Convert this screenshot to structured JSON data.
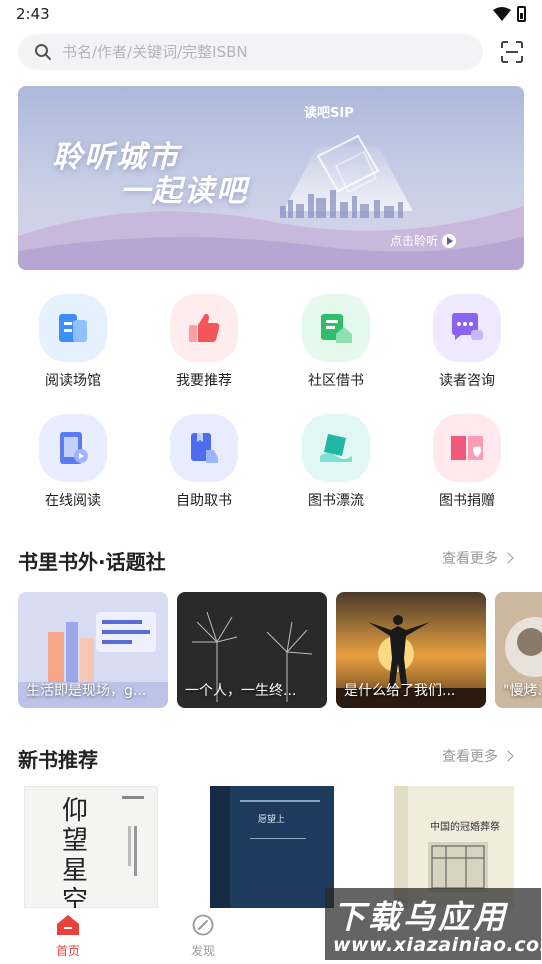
{
  "status_bar": {
    "time": "2:43"
  },
  "search": {
    "placeholder": "书名/作者/关键词/完整ISBN"
  },
  "banner": {
    "title_line1": "聆听城市",
    "title_line2": "一起读吧",
    "brand": "读吧SIP",
    "listen_label": "点击聆听"
  },
  "services": [
    {
      "label": "阅读场馆",
      "icon": "building-icon",
      "color": "#3d8ef8"
    },
    {
      "label": "我要推荐",
      "icon": "thumbs-up-icon",
      "color": "#f2555a"
    },
    {
      "label": "社区借书",
      "icon": "house-book-icon",
      "color": "#2fbf6a"
    },
    {
      "label": "读者咨询",
      "icon": "chat-bubble-icon",
      "color": "#8a64f0"
    },
    {
      "label": "在线阅读",
      "icon": "tablet-icon",
      "color": "#5b7bf0"
    },
    {
      "label": "自助取书",
      "icon": "pickup-icon",
      "color": "#4d6cf0"
    },
    {
      "label": "图书漂流",
      "icon": "drift-icon",
      "color": "#1fb8a6"
    },
    {
      "label": "图书捐赠",
      "icon": "heart-book-icon",
      "color": "#f05a7a"
    }
  ],
  "topics_section": {
    "title": "书里书外·话题社",
    "more_label": "查看更多",
    "items": [
      {
        "caption": "生活即是现场，g..."
      },
      {
        "caption": "一个人，一生终..."
      },
      {
        "caption": "是什么给了我们..."
      },
      {
        "caption": "\"慢烤..."
      }
    ]
  },
  "new_books_section": {
    "title": "新书推荐",
    "more_label": "查看更多",
    "books": [
      {
        "cover_title": "仰望星空"
      },
      {
        "cover_title": "愿望上"
      },
      {
        "cover_title": "中国的冠婚葬祭"
      }
    ]
  },
  "bottom_nav": [
    {
      "label": "首页",
      "icon": "home-icon",
      "active": true
    },
    {
      "label": "发现",
      "icon": "compass-icon",
      "active": false
    }
  ],
  "watermark": {
    "main": "下载乌应用",
    "url": "www.xiazainiao.com"
  },
  "colors": {
    "accent": "#e8423a",
    "muted": "#999999"
  }
}
